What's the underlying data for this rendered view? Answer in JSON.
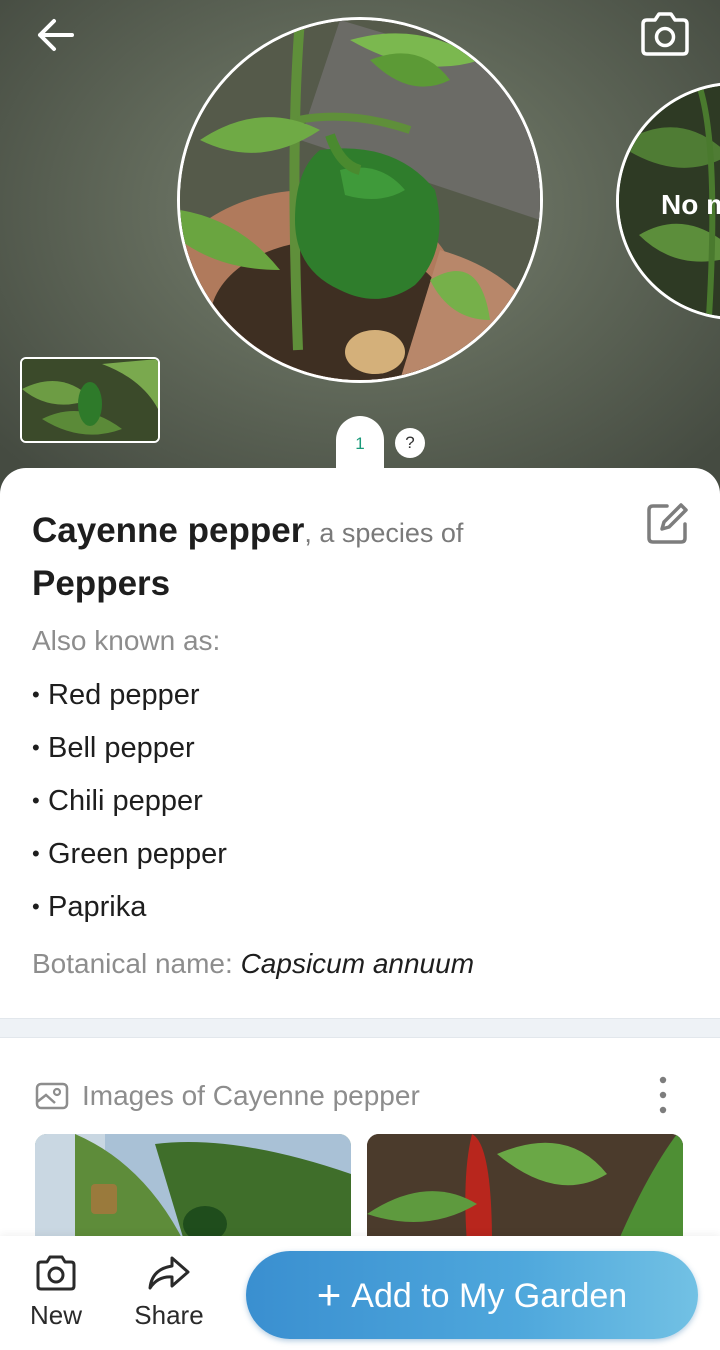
{
  "hero": {
    "side_photo_label": "No m",
    "page_indicator": "1",
    "help_label": "?"
  },
  "plant": {
    "common_name": "Cayenne pepper",
    "species_connector": ", a species of",
    "genus": "Peppers",
    "also_known_heading": "Also known as:",
    "also_known_as": [
      "Red pepper",
      "Bell pepper",
      "Chili pepper",
      "Green pepper",
      "Paprika"
    ],
    "botanical_label": "Botanical name:",
    "botanical_name": "Capsicum annuum"
  },
  "images_section": {
    "title": "Images of Cayenne pepper"
  },
  "bottom_bar": {
    "new_label": "New",
    "share_label": "Share",
    "add_label": "Add to My Garden"
  },
  "icons": {
    "back": "arrow-left-icon",
    "camera": "camera-icon",
    "edit": "edit-icon",
    "image": "image-icon",
    "more": "more-vertical-icon",
    "share": "share-icon",
    "add": "plus-icon"
  },
  "colors": {
    "accent": "#3a8fd0",
    "page_indicator": "#1a9a7a",
    "muted_text": "#8d8d8d"
  }
}
